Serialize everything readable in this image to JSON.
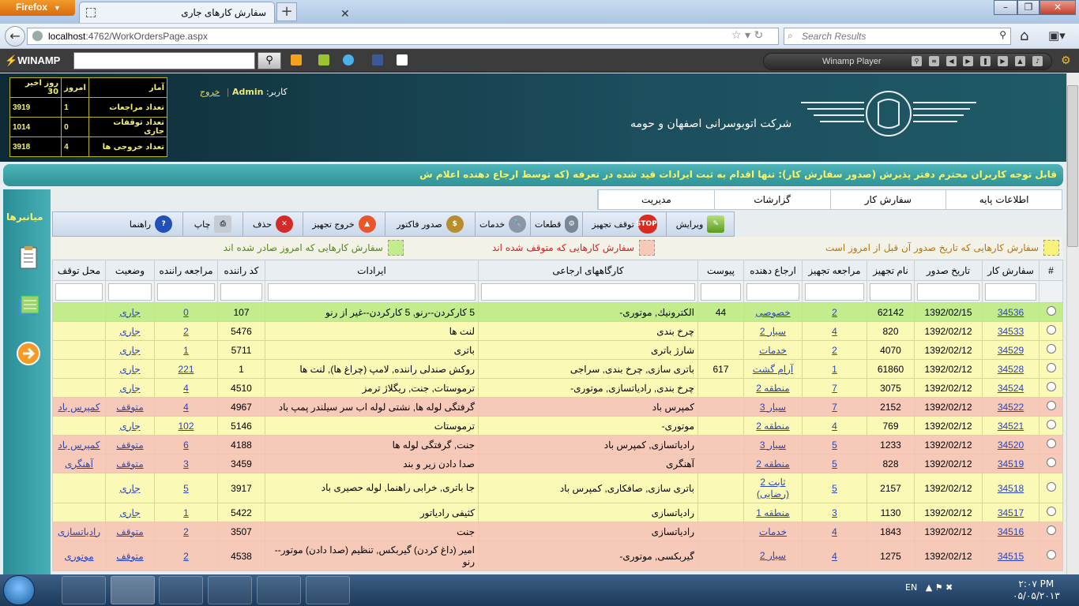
{
  "browser": {
    "app_button": "Firefox",
    "tab_title": "سفارش كارهاى جارى",
    "url_host": "localhost",
    "url_rest": ":4762/WorkOrdersPage.aspx",
    "search_placeholder": "Search Results"
  },
  "winamp": {
    "logo": "WINAMP",
    "player_label": "Winamp Player"
  },
  "header": {
    "user_label": "كاربر:",
    "user_name": "Admin",
    "logout": "خروج",
    "company": "شركت اتوبوسرانى اصفهان و حومه"
  },
  "stats": {
    "headers": [
      "آمار",
      "امروز",
      "روز اخير 30"
    ],
    "rows": [
      {
        "label": "تعداد مراجعات",
        "today": "1",
        "month": "3919"
      },
      {
        "label": "تعداد توقفات جارى",
        "today": "0",
        "month": "1014"
      },
      {
        "label": "تعداد خروجى ها",
        "today": "4",
        "month": "3918"
      }
    ]
  },
  "notice": "قابل توجه كاربران محترم دفتر پذيرش (صدور سفارش كار): تنها اقدام به ثبت ايرادات قيد شده در تعرفه (كه توسط ارجاع دهنده اعلام ش",
  "sidebar": {
    "title": "ميانبرها"
  },
  "menu": [
    "اطلاعات پايه",
    "سفارش كار",
    "گزارشات",
    "مديريت"
  ],
  "toolbar": [
    "ويرايش",
    "توقف تجهيز",
    "قطعات",
    "خدمات",
    "صدور فاكتور",
    "خروج تجهيز",
    "حذف",
    "چاپ",
    "راهنما"
  ],
  "legend": [
    "سفارش كارهايى كه تاريخ صدور آن قبل از امروز است",
    "سفارش كارهايى كه متوقف شده اند",
    "سفارش كارهايى كه امروز صادر شده اند"
  ],
  "colors": {
    "yellow_row": "#fbf9b6",
    "pink_row": "#f6c9b9",
    "green_row": "#c3ec8c",
    "notice_text": "#f6f46a"
  },
  "table": {
    "columns": [
      "#",
      "سفارش كار",
      "تاريخ صدور",
      "نام تجهيز",
      "مراجعه تجهيز",
      "ارجاع دهنده",
      "پيوست",
      "كارگاههاى ارجاعى",
      "ايرادات",
      "كد راننده",
      "مراجعه راننده",
      "وضعيت",
      "محل توقف"
    ],
    "rows": [
      {
        "t": "g",
        "id": "34536",
        "date": "1392/02/15",
        "eq": "62142",
        "ref": "2",
        "by": "خصوصى",
        "att": "44",
        "shops": "الكترونيك, موتورى-",
        "issues": "5 كاركردن--رنو, 5 كاركردن--غير از رنو",
        "driver": "107",
        "dref": "0",
        "status": "جارى",
        "stop": ""
      },
      {
        "t": "y",
        "id": "34533",
        "date": "1392/02/12",
        "eq": "820",
        "ref": "4",
        "by": "سيار 2",
        "att": "",
        "shops": "چرخ بندى",
        "issues": "لنت ها",
        "driver": "5476",
        "dref": "2",
        "status": "جارى",
        "stop": ""
      },
      {
        "t": "y",
        "id": "34529",
        "date": "1392/02/12",
        "eq": "4070",
        "ref": "2",
        "by": "خدمات",
        "att": "",
        "shops": "شارژ باترى",
        "issues": "باترى",
        "driver": "5711",
        "dref": "1",
        "status": "جارى",
        "stop": ""
      },
      {
        "t": "y",
        "id": "34528",
        "date": "1392/02/12",
        "eq": "61860",
        "ref": "1",
        "by": "آرام گشت",
        "att": "617",
        "shops": "باترى سازى, چرخ بندى, سراجى",
        "issues": "روكش صندلى راننده, لامپ (چراغ ها), لنت ها",
        "driver": "1",
        "dref": "221",
        "status": "جارى",
        "stop": ""
      },
      {
        "t": "y",
        "id": "34524",
        "date": "1392/02/12",
        "eq": "3075",
        "ref": "7",
        "by": "منطقه 2",
        "att": "",
        "shops": "چرخ بندى, رادياتسازى, موتورى-",
        "issues": "ترموستات, جنت, ريگلاژ ترمز",
        "driver": "4510",
        "dref": "4",
        "status": "جارى",
        "stop": ""
      },
      {
        "t": "p",
        "id": "34522",
        "date": "1392/02/12",
        "eq": "2152",
        "ref": "7",
        "by": "سيار 3",
        "att": "",
        "shops": "كمپرس باد",
        "issues": "گرفتگى لوله ها, نشتى لوله اب سر سيلندر پمپ باد",
        "driver": "4967",
        "dref": "4",
        "status": "متوقف",
        "stop": "كمپرس باد"
      },
      {
        "t": "y",
        "id": "34521",
        "date": "1392/02/12",
        "eq": "769",
        "ref": "4",
        "by": "منطقه 2",
        "att": "",
        "shops": "موتورى-",
        "issues": "ترموستات",
        "driver": "5146",
        "dref": "102",
        "status": "جارى",
        "stop": ""
      },
      {
        "t": "p",
        "id": "34520",
        "date": "1392/02/12",
        "eq": "1233",
        "ref": "5",
        "by": "سيار 3",
        "att": "",
        "shops": "رادياتسازى, كمپرس باد",
        "issues": "جنت, گرفتگى لوله ها",
        "driver": "4188",
        "dref": "6",
        "status": "متوقف",
        "stop": "كمپرس باد"
      },
      {
        "t": "p",
        "id": "34519",
        "date": "1392/02/12",
        "eq": "828",
        "ref": "5",
        "by": "منطقه 2",
        "att": "",
        "shops": "آهنگرى",
        "issues": "صدا دادن زير و بند",
        "driver": "3459",
        "dref": "3",
        "status": "متوقف",
        "stop": "آهنگرى"
      },
      {
        "t": "y",
        "tall": true,
        "id": "34518",
        "date": "1392/02/12",
        "eq": "2157",
        "ref": "5",
        "by": "ثابت 2 (رضايى)",
        "att": "",
        "shops": "باترى سازى, صافكارى, كمپرس باد",
        "issues": "جا باترى, خرابى راهنما, لوله حصيرى باد",
        "driver": "3917",
        "dref": "5",
        "status": "جارى",
        "stop": ""
      },
      {
        "t": "y",
        "id": "34517",
        "date": "1392/02/12",
        "eq": "1130",
        "ref": "3",
        "by": "منطقه 1",
        "att": "",
        "shops": "رادياتسازى",
        "issues": "كثيفى رادياتور",
        "driver": "5422",
        "dref": "1",
        "status": "جارى",
        "stop": ""
      },
      {
        "t": "p",
        "id": "34516",
        "date": "1392/02/12",
        "eq": "1843",
        "ref": "4",
        "by": "خدمات",
        "att": "",
        "shops": "رادياتسازى",
        "issues": "جنت",
        "driver": "3507",
        "dref": "2",
        "status": "متوقف",
        "stop": "رادياتسازى"
      },
      {
        "t": "p",
        "tall": true,
        "id": "34515",
        "date": "1392/02/12",
        "eq": "1275",
        "ref": "4",
        "by": "سيار 2",
        "att": "",
        "shops": "گيربكسى, موتورى-",
        "issues": "امير (داغ كردن) گيربكس, تنظيم (صدا دادن) موتور--رنو",
        "driver": "4538",
        "dref": "2",
        "status": "متوقف",
        "stop": "موتورى"
      }
    ]
  },
  "taskbar": {
    "lang": "EN",
    "time": "۲:۰۷ PM",
    "date": "۰۵/۰۵/۲۰۱۳"
  }
}
